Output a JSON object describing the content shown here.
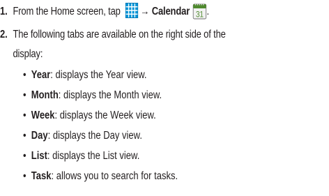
{
  "steps": [
    {
      "number": "1.",
      "before": "From the Home screen, tap ",
      "arrow": "→ ",
      "target": "Calendar",
      "after": "."
    },
    {
      "number": "2.",
      "line1": "The following tabs are available on the right side of the",
      "line2": "display:"
    }
  ],
  "icons": {
    "apps": "apps-grid-icon",
    "calendar": "calendar-icon",
    "calendar_day": "31",
    "apps_color": "#0093d6",
    "calendar_color": "#4f8a2e"
  },
  "bullet_glyph": "•",
  "tabs": [
    {
      "name": "Year",
      "desc": ": displays the Year view."
    },
    {
      "name": "Month",
      "desc": ": displays the Month view."
    },
    {
      "name": "Week",
      "desc": ": displays the Week view."
    },
    {
      "name": "Day",
      "desc": ": displays the Day view."
    },
    {
      "name": "List",
      "desc": ": displays the List view."
    },
    {
      "name": "Task",
      "desc": ": allows you to search for tasks."
    }
  ]
}
